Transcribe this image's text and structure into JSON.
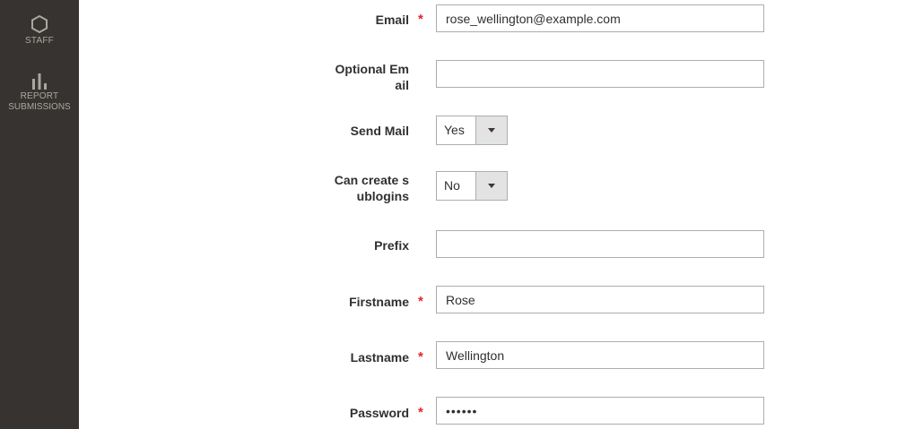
{
  "sidebar": {
    "items": [
      {
        "label": "STAFF",
        "icon": "hexagon-icon"
      },
      {
        "label": "REPORT",
        "label2": "SUBMISSIONS",
        "icon": "bar-chart-icon"
      }
    ]
  },
  "form": {
    "email": {
      "label": "Email",
      "required": "*",
      "value": "rose_wellington@example.com"
    },
    "optional_email": {
      "label_line1": "Optional Em",
      "label_line2": "ail",
      "value": ""
    },
    "send_mail": {
      "label": "Send Mail",
      "value": "Yes"
    },
    "can_create_sublogins": {
      "label_line1": "Can create s",
      "label_line2": "ublogins",
      "value": "No"
    },
    "prefix": {
      "label": "Prefix",
      "value": ""
    },
    "firstname": {
      "label": "Firstname",
      "required": "*",
      "value": "Rose"
    },
    "lastname": {
      "label": "Lastname",
      "required": "*",
      "value": "Wellington"
    },
    "password": {
      "label": "Password",
      "required": "*",
      "value": "••••••"
    }
  }
}
